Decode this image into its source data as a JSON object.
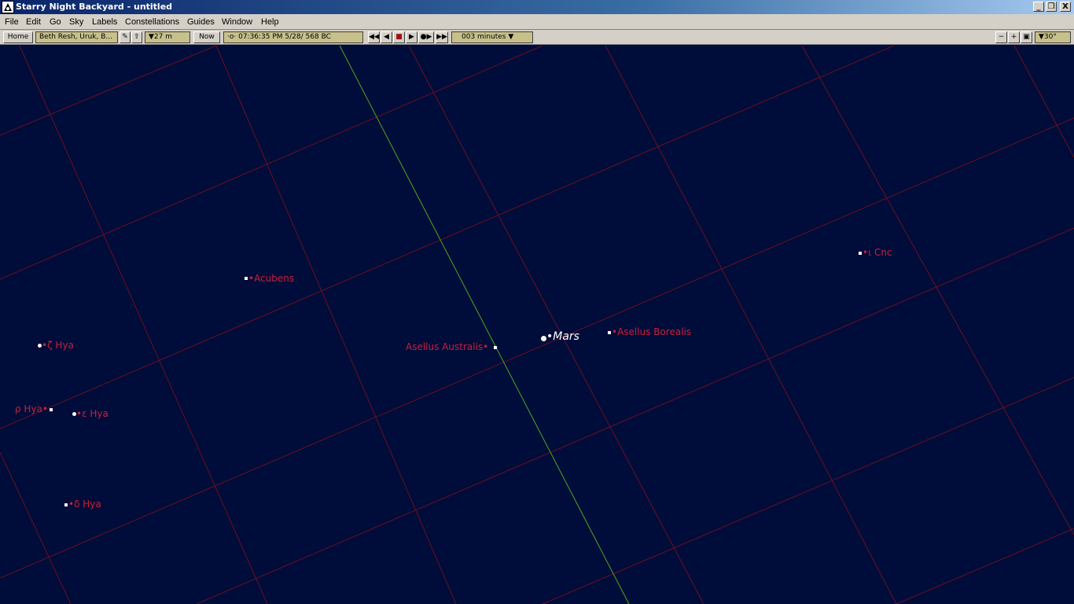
{
  "window": {
    "title": "Starry Night Backyard - untitled",
    "minimize_label": "_",
    "restore_label": "❐",
    "close_label": "X"
  },
  "menu": {
    "file": "File",
    "edit": "Edit",
    "go": "Go",
    "sky": "Sky",
    "labels": "Labels",
    "constellations": "Constellations",
    "guides": "Guides",
    "window": "Window",
    "help": "Help"
  },
  "toolbar": {
    "home_label": "Home",
    "location_value": "Beth Resh, Uruk, B...",
    "elevation_value": "▼27 m",
    "now_label": "Now",
    "time_value": "·o· 07:36:35 PM    5/28/  568 BC",
    "time_step_value": "003 minutes ▼",
    "fov_value": "▼30°",
    "rewind_icon": "rewind-icon",
    "step_back_icon": "step-back-icon",
    "stop_icon": "stop-icon",
    "play_icon": "play-icon",
    "step_forward_icon": "step-forward-icon",
    "fast_forward_icon": "fast-forward-icon",
    "zoom_out_icon": "zoom-out-icon",
    "zoom_in_icon": "zoom-in-icon",
    "zoom_fit_icon": "zoom-fit-icon"
  },
  "colors": {
    "sky_background": "#000c3a",
    "grid_line": "#6b0f1f",
    "ecliptic_line": "#4caa1e",
    "star_label": "#c8203a",
    "planet_label": "#ffffff"
  },
  "sky": {
    "labels": {
      "acubens": "Acubens",
      "zeta_hya": "ζ Hya",
      "rho_hya": "ρ Hya",
      "epsilon_hya": "ε Hya",
      "delta_hya": "δ Hya",
      "asellus_australis": "Asellus Australis",
      "mars": "Mars",
      "asellus_borealis": "Asellus Borealis",
      "iota_cnc": "ι Cnc"
    }
  }
}
